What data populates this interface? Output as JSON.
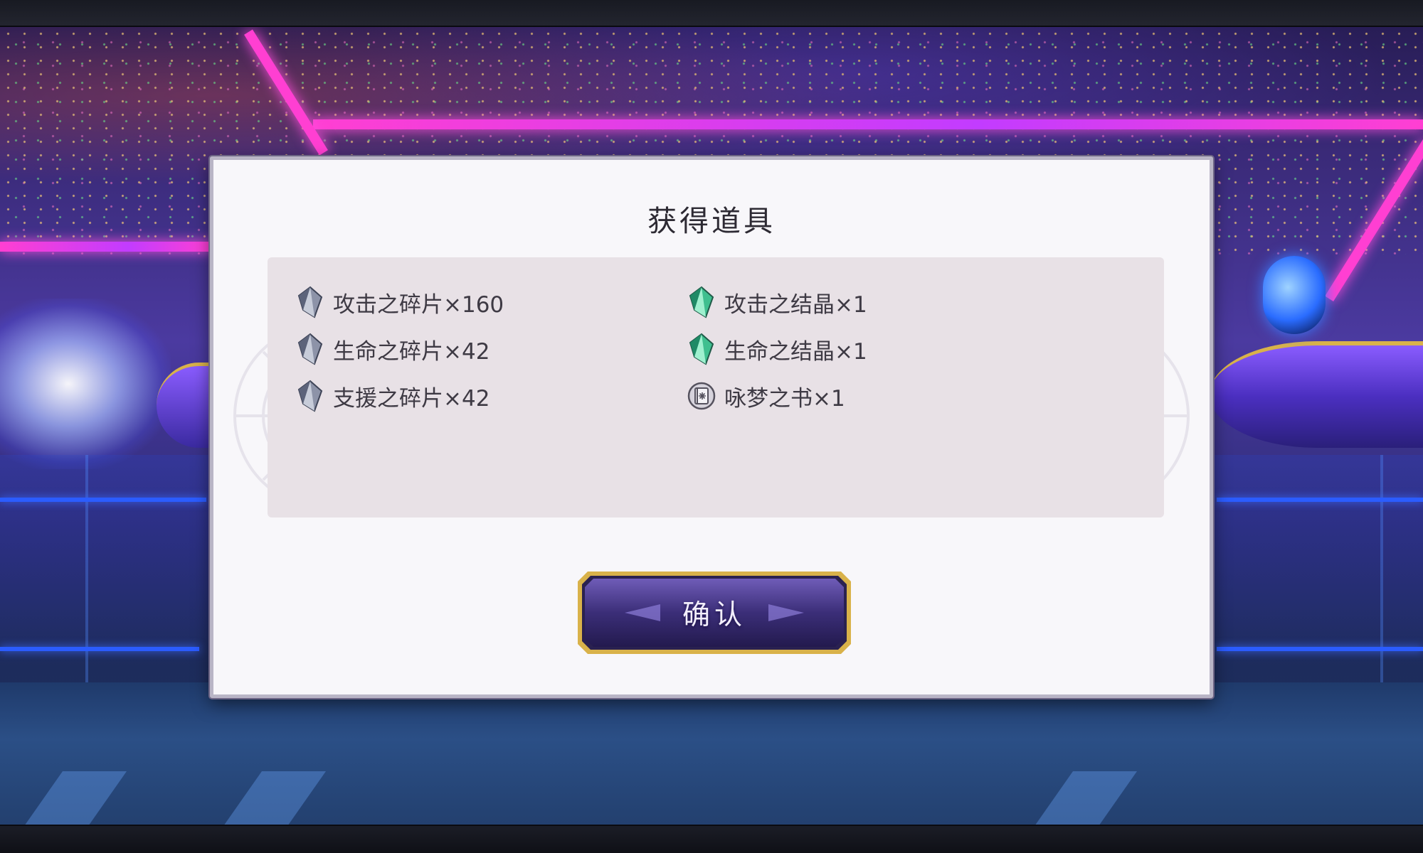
{
  "dialog": {
    "title": "获得道具",
    "items": [
      {
        "label": "攻击之碎片×160",
        "icon": "shard-crystal-icon"
      },
      {
        "label": "生命之碎片×42",
        "icon": "shard-crystal-icon"
      },
      {
        "label": "支援之碎片×42",
        "icon": "shard-crystal-icon"
      },
      {
        "label": "攻击之结晶×1",
        "icon": "green-crystal-icon"
      },
      {
        "label": "生命之结晶×1",
        "icon": "green-crystal-icon"
      },
      {
        "label": "咏梦之书×1",
        "icon": "book-icon"
      }
    ],
    "confirm_label": "确认"
  },
  "colors": {
    "accent_neon": "#ff3fd2",
    "button_gold": "#d9b24a",
    "button_purple": "#3b2e78",
    "panel_bg": "#e8e1e6",
    "dialog_bg": "#f8f7fa"
  }
}
